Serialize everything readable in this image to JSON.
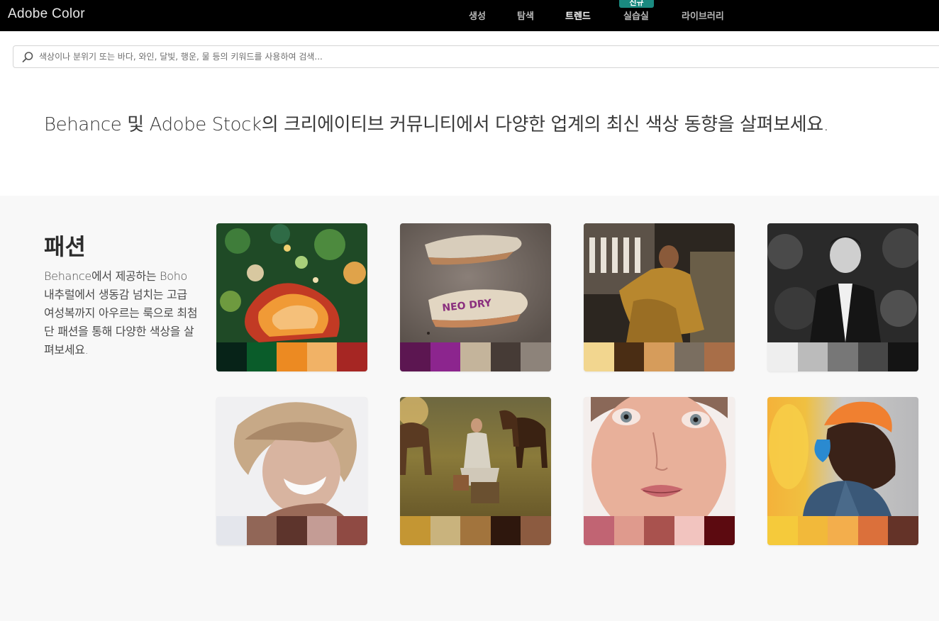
{
  "app": {
    "title": "Adobe Color"
  },
  "nav": {
    "items": [
      {
        "label": "생성",
        "active": false
      },
      {
        "label": "탐색",
        "active": false
      },
      {
        "label": "트렌드",
        "active": true
      },
      {
        "label": "실습실",
        "active": false,
        "badge": "신규"
      },
      {
        "label": "라이브러리",
        "active": false
      }
    ]
  },
  "search": {
    "placeholder": "색상이나 분위기 또는 바다, 와인, 달빛, 행운, 물 등의 키워드를 사용하여 검색...",
    "value": ""
  },
  "headline": "Behance 및 Adobe Stock의 크리에이티브 커뮤니티에서 다양한 업계의 최신 색상 동향을 살펴보세요.",
  "section": {
    "title": "패션",
    "description": "Behance에서 제공하는 Boho 내추럴에서 생동감 넘치는 고급 여성복까지 아우르는 룩으로 최첨단 패션을 통해 다양한 색상을 살펴보세요."
  },
  "cards": [
    {
      "photo": "colorful-illustration",
      "swatches": [
        "#072318",
        "#0a5c2a",
        "#ec8a22",
        "#f1b266",
        "#a62623"
      ]
    },
    {
      "photo": "sneakers",
      "swatches": [
        "#5c1651",
        "#8c258e",
        "#c4b49b",
        "#463b36",
        "#8d837a"
      ]
    },
    {
      "photo": "woman-gold-dress",
      "swatches": [
        "#f2d68f",
        "#4a2d14",
        "#d69c5b",
        "#7a6e60",
        "#a86e48"
      ]
    },
    {
      "photo": "man-black-white",
      "swatches": [
        "#eeeeee",
        "#bbbbbb",
        "#777777",
        "#474747",
        "#141414"
      ]
    },
    {
      "photo": "smiling-blonde",
      "swatches": [
        "#e4e6ec",
        "#916657",
        "#5d342c",
        "#c49c95",
        "#8f4a43"
      ]
    },
    {
      "photo": "woman-horses",
      "swatches": [
        "#c49633",
        "#c9b37d",
        "#a2743d",
        "#2e170d",
        "#8c5b40"
      ]
    },
    {
      "photo": "face-closeup",
      "swatches": [
        "#c16473",
        "#df9a8d",
        "#a9524e",
        "#f2c4bf",
        "#5c0a10"
      ]
    },
    {
      "photo": "orange-hair-man",
      "swatches": [
        "#f5ca3b",
        "#f2b93a",
        "#f3ae4c",
        "#db703b",
        "#643328"
      ]
    }
  ]
}
